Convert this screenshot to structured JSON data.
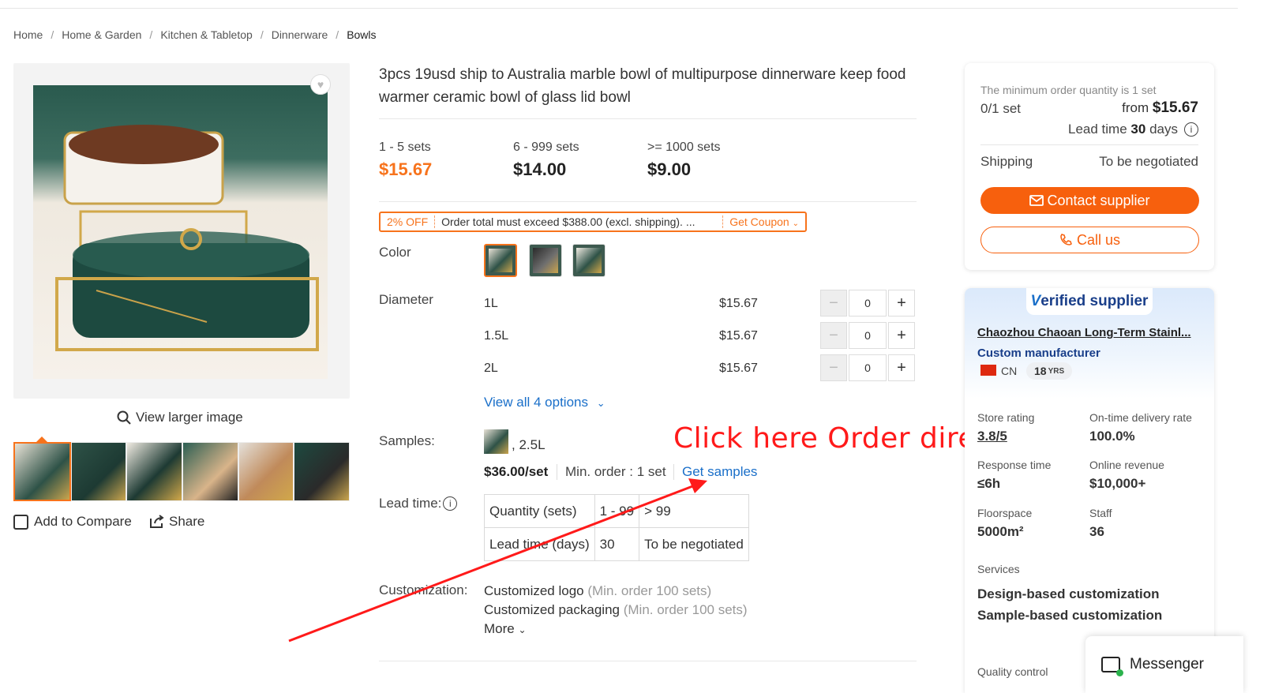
{
  "breadcrumb": [
    "Home",
    "Home & Garden",
    "Kitchen & Tabletop",
    "Dinnerware",
    "Bowls"
  ],
  "gallery": {
    "view_larger": "View larger image",
    "add_compare": "Add to Compare",
    "share": "Share"
  },
  "product": {
    "title": "3pcs 19usd ship to Australia marble bowl of multipurpose dinnerware keep food warmer ceramic bowl of glass lid bowl",
    "tiers": [
      {
        "qty": "1 - 5 sets",
        "price": "$15.67"
      },
      {
        "qty": "6 - 999 sets",
        "price": "$14.00"
      },
      {
        "qty": ">= 1000 sets",
        "price": "$9.00"
      }
    ],
    "coupon": {
      "off": "2% OFF",
      "message": "Order total must exceed $388.00 (excl. shipping). ...",
      "get": "Get Coupon"
    },
    "color_label": "Color",
    "diameter_label": "Diameter",
    "diameters": [
      {
        "name": "1L",
        "price": "$15.67",
        "qty": "0"
      },
      {
        "name": "1.5L",
        "price": "$15.67",
        "qty": "0"
      },
      {
        "name": "2L",
        "price": "$15.67",
        "qty": "0"
      }
    ],
    "view_all": "View all 4 options",
    "samples_label": "Samples:",
    "sample_variant": ", 2.5L",
    "sample_price": "$36.00/set",
    "sample_min": "Min. order : 1 set",
    "get_samples": "Get samples",
    "lead_label": "Lead time:",
    "lead_table": {
      "row1": [
        "Quantity (sets)",
        "1 - 99",
        "> 99"
      ],
      "row2": [
        "Lead time (days)",
        "30",
        "To be negotiated"
      ]
    },
    "custom_label": "Customization:",
    "custom_items": [
      {
        "name": "Customized logo",
        "note": "(Min. order 100 sets)"
      },
      {
        "name": "Customized packaging",
        "note": "(Min. order 100 sets)"
      }
    ],
    "more": "More"
  },
  "annotation": "Click here Order directly",
  "order_panel": {
    "moq": "The minimum order quantity is 1 set",
    "count": "0/1 set",
    "from": "from",
    "from_price": "$15.67",
    "lead_prefix": "Lead time",
    "lead_days": "30",
    "lead_suffix": "days",
    "shipping_label": "Shipping",
    "shipping_value": "To be negotiated",
    "contact": "Contact supplier",
    "call": "Call us"
  },
  "supplier": {
    "badge_v": "V",
    "badge_rest": "erified supplier",
    "name": "Chaozhou Chaoan Long-Term Stainl...",
    "type": "Custom manufacturer",
    "country": "CN",
    "years": "18",
    "years_unit": "YRS",
    "stats": [
      {
        "label": "Store rating",
        "value": "3.8/5"
      },
      {
        "label": "On-time delivery rate",
        "value": "100.0%"
      },
      {
        "label": "Response time",
        "value": "≤6h"
      },
      {
        "label": "Online revenue",
        "value": "$10,000+"
      },
      {
        "label": "Floorspace",
        "value": "5000m²"
      },
      {
        "label": "Staff",
        "value": "36"
      }
    ],
    "services_label": "Services",
    "services": [
      "Design-based customization",
      "Sample-based customization"
    ],
    "quality_label": "Quality control"
  },
  "messenger": "Messenger",
  "colors": {
    "accent": "#f7731c",
    "link": "#1a6fc9",
    "annotation": "#ff1a1a"
  }
}
